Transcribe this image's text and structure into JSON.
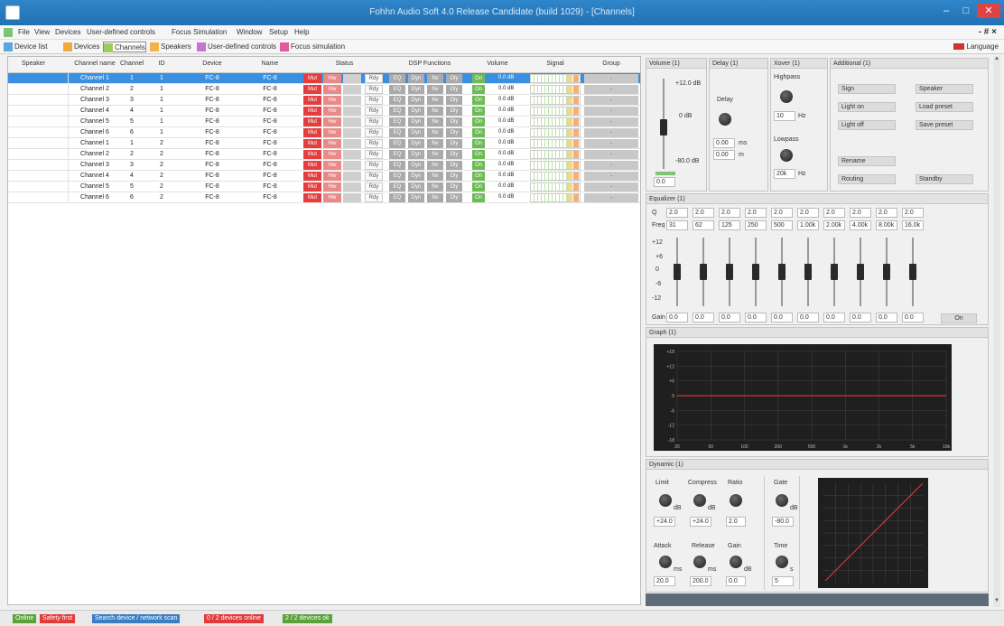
{
  "window": {
    "title": "Fohhn Audio Soft 4.0 Release Candidate (build 1029) - [Channels]",
    "min": "–",
    "max": "□",
    "close": "✕"
  },
  "menu": {
    "items": [
      "File",
      "View",
      "Devices",
      "User-defined controls",
      "Focus Simulation",
      "Window",
      "Setup",
      "Help"
    ],
    "mdi_controls": "- # ×"
  },
  "toolbar": {
    "tabs": [
      {
        "label": "Device list",
        "color": "#5aa7e0"
      },
      {
        "label": "Devices",
        "color": "#f2a93b"
      },
      {
        "label": "Channels",
        "color": "#9ccd5a"
      },
      {
        "label": "Speakers",
        "color": "#f2b34b"
      },
      {
        "label": "User-defined controls",
        "color": "#c972d6"
      },
      {
        "label": "Focus simulation",
        "color": "#e05aa0"
      }
    ],
    "language": "Language"
  },
  "table": {
    "headers": [
      "Speaker",
      "Channel name",
      "Channel",
      "ID",
      "Device",
      "Name",
      "Status",
      "DSP Functions",
      "Volume",
      "Signal",
      "Group"
    ],
    "rows": [
      {
        "name": "Channel 1",
        "ch": "1",
        "id": "1",
        "device": "FC-8",
        "dname": "FC-8",
        "vol": "0.0 dB"
      },
      {
        "name": "Channel 2",
        "ch": "2",
        "id": "1",
        "device": "FC-8",
        "dname": "FC-8",
        "vol": "0.0 dB"
      },
      {
        "name": "Channel 3",
        "ch": "3",
        "id": "1",
        "device": "FC-8",
        "dname": "FC-8",
        "vol": "0.0 dB"
      },
      {
        "name": "Channel 4",
        "ch": "4",
        "id": "1",
        "device": "FC-8",
        "dname": "FC-8",
        "vol": "0.0 dB"
      },
      {
        "name": "Channel 5",
        "ch": "5",
        "id": "1",
        "device": "FC-8",
        "dname": "FC-8",
        "vol": "0.0 dB"
      },
      {
        "name": "Channel 6",
        "ch": "6",
        "id": "1",
        "device": "FC-8",
        "dname": "FC-8",
        "vol": "0.0 dB"
      },
      {
        "name": "Channel 1",
        "ch": "1",
        "id": "2",
        "device": "FC-8",
        "dname": "FC-8",
        "vol": "0.0 dB"
      },
      {
        "name": "Channel 2",
        "ch": "2",
        "id": "2",
        "device": "FC-8",
        "dname": "FC-8",
        "vol": "0.0 dB"
      },
      {
        "name": "Channel 3",
        "ch": "3",
        "id": "2",
        "device": "FC-8",
        "dname": "FC-8",
        "vol": "0.0 dB"
      },
      {
        "name": "Channel 4",
        "ch": "4",
        "id": "2",
        "device": "FC-8",
        "dname": "FC-8",
        "vol": "0.0 dB"
      },
      {
        "name": "Channel 5",
        "ch": "5",
        "id": "2",
        "device": "FC-8",
        "dname": "FC-8",
        "vol": "0.0 dB"
      },
      {
        "name": "Channel 6",
        "ch": "6",
        "id": "2",
        "device": "FC-8",
        "dname": "FC-8",
        "vol": "0.0 dB"
      }
    ],
    "cells": {
      "mute": "Mut",
      "hw": "Hw",
      "rdy": "Rdy",
      "dsp": [
        "EQ",
        "Dyn",
        "Nv",
        "Dly"
      ],
      "on": "On",
      "group": "-"
    }
  },
  "volume_panel": {
    "title": "Volume (1)",
    "max_label": "+12.0 dB",
    "mid_label": "0 dB",
    "min_label": "-80.0 dB",
    "value": "0.0",
    "level": 0.13
  },
  "delay_panel": {
    "title": "Delay (1)",
    "label": "Delay",
    "ms_value": "0.00",
    "ms_unit": "ms",
    "m_value": "0.00",
    "m_unit": "m"
  },
  "xover_panel": {
    "title": "Xover (1)",
    "highpass": "Highpass",
    "hp_value": "10",
    "hp_unit": "Hz",
    "lowpass": "Lowpass",
    "lp_value": "20k",
    "lp_unit": "Hz"
  },
  "additional_panel": {
    "title": "Additional (1)",
    "buttons": [
      "Sign",
      "Speaker",
      "Light on",
      "Load preset",
      "Light off",
      "Save preset",
      "Rename",
      "Routing",
      "Standby"
    ]
  },
  "equalizer": {
    "title": "Equalizer (1)",
    "q_label": "Q",
    "freq_label": "Freq",
    "gain_label": "Gain",
    "q": [
      "2.0",
      "2.0",
      "2.0",
      "2.0",
      "2.0",
      "2.0",
      "2.0",
      "2.0",
      "2.0",
      "2.0"
    ],
    "freq": [
      "31",
      "62",
      "125",
      "250",
      "500",
      "1.00k",
      "2.00k",
      "4.00k",
      "8.00k",
      "16.0k"
    ],
    "gain": [
      "0.0",
      "0.0",
      "0.0",
      "0.0",
      "0.0",
      "0.0",
      "0.0",
      "0.0",
      "0.0",
      "0.0"
    ],
    "scale": [
      "+12",
      "+6",
      "0",
      "-6",
      "-12"
    ],
    "on_label": "On"
  },
  "graph": {
    "title": "Graph (1)",
    "x_ticks": [
      "20",
      "50",
      "100",
      "200",
      "500",
      "1k",
      "2k",
      "5k",
      "10k"
    ],
    "y_ticks": [
      "+18",
      "+12",
      "+6",
      "0",
      "-6",
      "-12",
      "-18"
    ],
    "response": [
      0,
      0,
      0,
      0,
      0,
      0,
      0,
      0,
      0
    ],
    "accent": "#e03030"
  },
  "dynamic": {
    "title": "Dynamic (1)",
    "limit": "Limit",
    "compress": "Compress",
    "ratio": "Ratio",
    "gate": "Gate",
    "attack": "Attack",
    "release": "Release",
    "gain": "Gain",
    "time": "Time",
    "db": "dB",
    "ms": "ms",
    "s": "s",
    "limit_value": "+24.0",
    "compress_value": "+24.0",
    "ratio_value": "2.0",
    "gate_value": "-80.0",
    "attack_value": "20.0",
    "release_value": "200.0",
    "gain_value": "0.0",
    "time_value": "5"
  },
  "statusbar": {
    "items": [
      {
        "label": "Online",
        "color": "#5aa23c"
      },
      {
        "label": "Safety first",
        "color": "#e03c3c"
      },
      {
        "label": "Search device / network scan",
        "color": "#3a7fc4"
      },
      {
        "label": "0 / 2 devices online",
        "color": "#e03c3c"
      },
      {
        "label": "2 / 2 devices ok",
        "color": "#5aa23c"
      }
    ]
  }
}
